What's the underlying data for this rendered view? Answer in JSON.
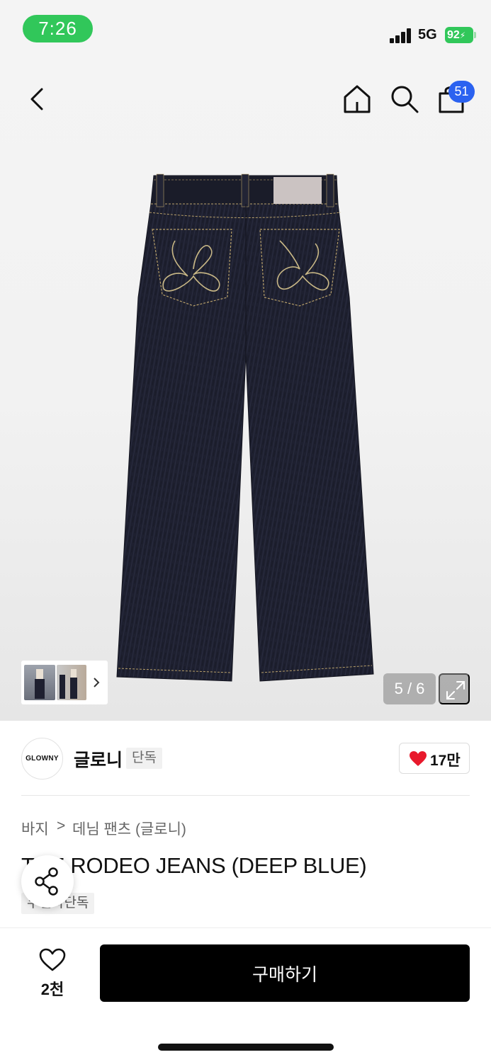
{
  "status_bar": {
    "time": "7:26",
    "network": "5G",
    "battery": "92"
  },
  "nav": {
    "cart_count": "51"
  },
  "gallery": {
    "counter": "5 / 6"
  },
  "brand": {
    "logo_text": "GLOWNY",
    "name": "글로니",
    "badge": "단독",
    "like_count": "17만"
  },
  "breadcrumb": {
    "category": "바지",
    "separator": ">",
    "subcategory": "데님 팬츠 (글로니)"
  },
  "product": {
    "title": "THE RODEO JEANS (DEEP BLUE)",
    "tag": "무신사단독"
  },
  "bottom_bar": {
    "wish_count": "2천",
    "buy_label": "구매하기"
  },
  "colors": {
    "accent_green": "#31c75a",
    "badge_blue": "#2b62f0",
    "heart_red": "#e8192c",
    "denim": "#1d1f2b"
  }
}
